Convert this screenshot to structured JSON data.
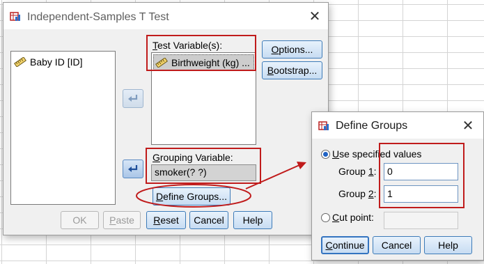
{
  "main_dialog": {
    "title": "Independent-Samples T Test",
    "source_vars": [
      {
        "label": "Baby ID [ID]",
        "icon": "ruler-scale-icon"
      }
    ],
    "test_variables_label": "Test Variable(s):",
    "test_variables_label_key": "T",
    "test_variables_label_rest": "est Variable(s):",
    "test_variables": [
      {
        "label": "Birthweight (kg) ...",
        "icon": "ruler-scale-icon"
      }
    ],
    "grouping_label_key": "G",
    "grouping_label_rest": "rouping Variable:",
    "grouping_value": "smoker(? ?)",
    "define_groups_key": "D",
    "define_groups_rest": "efine Groups...",
    "options_key": "O",
    "options_rest": "ptions...",
    "bootstrap_key": "B",
    "bootstrap_rest": "ootstrap...",
    "buttons": {
      "ok": "OK",
      "paste_key": "P",
      "paste_rest": "aste",
      "reset_key": "R",
      "reset_rest": "eset",
      "cancel": "Cancel",
      "help": "Help"
    }
  },
  "define_groups_dialog": {
    "title": "Define Groups",
    "use_specified_key": "U",
    "use_specified_rest": "se specified values",
    "use_specified_checked": true,
    "group1_label_main": "Group ",
    "group1_label_key": "1",
    "group1_label_suffix": ":",
    "group1_value": "0",
    "group2_label_main": "Group ",
    "group2_label_key": "2",
    "group2_label_suffix": ":",
    "group2_value": "1",
    "cut_point_key": "C",
    "cut_point_rest": "ut point:",
    "cut_point_checked": false,
    "cut_point_value": "",
    "buttons": {
      "continue_key": "C",
      "continue_rest": "ontinue",
      "cancel": "Cancel",
      "help": "Help"
    }
  },
  "colors": {
    "annotation_red": "#c01b1b",
    "accent_blue": "#3474c0"
  }
}
